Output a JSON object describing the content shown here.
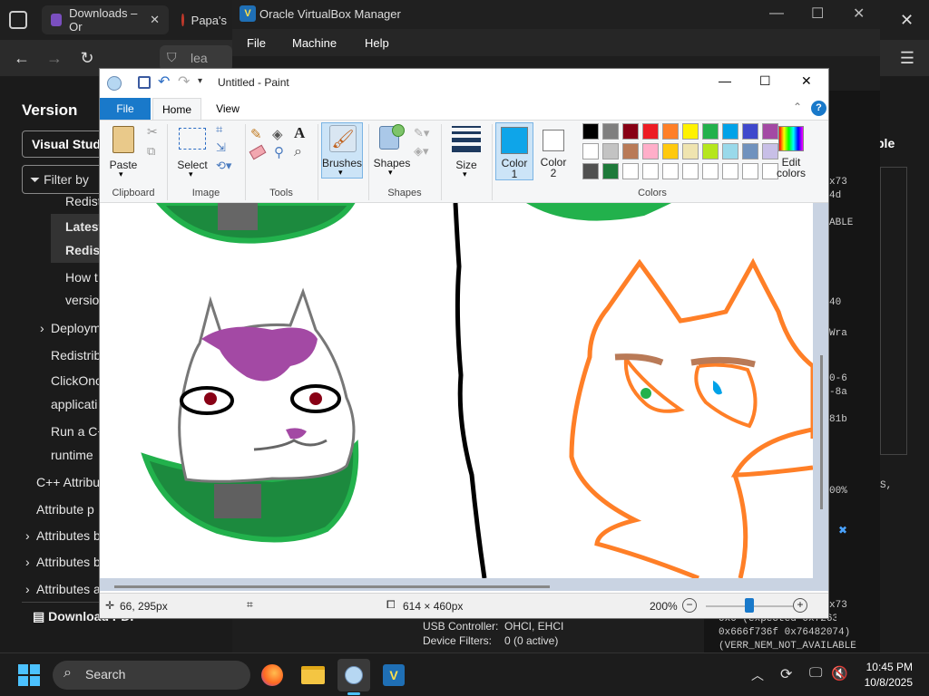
{
  "browser": {
    "tabs": [
      {
        "label": "Downloads – Or"
      },
      {
        "label": "Papa's"
      }
    ],
    "address": "lea"
  },
  "docs": {
    "section_title": "Version",
    "version_select": "Visual Studio",
    "filter_placeholder": "Filter by",
    "toc": [
      "Redist",
      "Latest",
      "Redist",
      "How t",
      "versio",
      "Deploym",
      "Redistrib",
      "ClickOnc",
      "applicati",
      "Run a C+",
      "runtime",
      "C++ Attribu",
      "Attribute p",
      "Attributes b",
      "Attributes b",
      "Attributes a"
    ],
    "download_pdf": "Download PDF"
  },
  "right_panel": {
    "heading_fragment": "ble",
    "fragments": [
      "x73",
      "4d",
      "ABLE",
      "40",
      "Wra",
      "0-6",
      "-8a",
      "81b",
      "00%",
      "S,"
    ]
  },
  "virtualbox": {
    "title": "Oracle VirtualBox Manager",
    "menu": [
      "File",
      "Machine",
      "Help"
    ],
    "details": [
      {
        "label": "USB Controller:",
        "value": "OHCI, EHCI"
      },
      {
        "label": "Device Filters:",
        "value": "0 (0 active)"
      }
    ],
    "log_lines": [
      "x73",
      "0x0 (expected 0x7263694d",
      "0x666f736f 0x76482074)",
      "(VERR_NEM_NOT_AVAILABLE"
    ]
  },
  "paint": {
    "title": "Untitled - Paint",
    "ribbon_tabs": [
      "File",
      "Home",
      "View"
    ],
    "groups": {
      "clipboard": "Clipboard",
      "image": "Image",
      "tools": "Tools",
      "shapes": "Shapes",
      "colors": "Colors"
    },
    "buttons": {
      "paste": "Paste",
      "select": "Select",
      "brushes": "Brushes",
      "shapes": "Shapes",
      "size": "Size",
      "color1_line1": "Color",
      "color1_line2": "1",
      "color2_line1": "Color",
      "color2_line2": "2",
      "edit_colors_line1": "Edit",
      "edit_colors_line2": "colors"
    },
    "color1": "#0ea5e9",
    "color2": "#ffffff",
    "palette": [
      "#000000",
      "#7f7f7f",
      "#880015",
      "#ed1c24",
      "#ff7f27",
      "#fff200",
      "#22b14c",
      "#00a2e8",
      "#3f48cc",
      "#a349a4",
      "#ffffff",
      "#c3c3c3",
      "#b97a57",
      "#ffaec9",
      "#ffc90e",
      "#efe4b0",
      "#b5e61d",
      "#99d9ea",
      "#7092be",
      "#c8bfe7",
      "#505050",
      "#1e7a3a",
      "#ffffff",
      "#ffffff",
      "#ffffff",
      "#ffffff",
      "#ffffff",
      "#ffffff",
      "#ffffff",
      "#ffffff"
    ],
    "status": {
      "cursor": "66, 295px",
      "size": "614 × 460px",
      "zoom": "200%",
      "zoom_level": 0.5
    }
  },
  "taskbar": {
    "search": "Search",
    "time": "10:45 PM",
    "date": "10/8/2025"
  }
}
